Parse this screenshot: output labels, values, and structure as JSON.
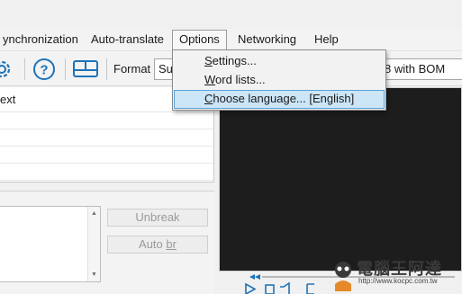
{
  "menubar": {
    "items": [
      {
        "label": "ynchronization"
      },
      {
        "label": "Auto-translate"
      },
      {
        "label": "Options"
      },
      {
        "label": "Networking"
      },
      {
        "label": "Help"
      }
    ]
  },
  "toolbar": {
    "format_label": "Format",
    "format_value": "Su",
    "encoding_value": "8 with BOM",
    "icons": [
      "settings-gear-icon",
      "help-circle-icon",
      "layout-icon"
    ]
  },
  "grid": {
    "header_text": "ext"
  },
  "options_menu": {
    "items": [
      {
        "prefix": "",
        "key": "S",
        "rest": "ettings..."
      },
      {
        "prefix": "",
        "key": "W",
        "rest": "ord lists..."
      },
      {
        "prefix": "",
        "key": "C",
        "rest": "hoose language... [English]"
      }
    ]
  },
  "edit": {
    "unbreak_label": "Unbreak",
    "autobr_label_prefix": "Auto ",
    "autobr_label_key": "br"
  },
  "watermark": {
    "text": "電腦王阿達",
    "url": "http://www.kocpc.com.tw"
  },
  "colors": {
    "highlight_bg": "#cce5f7",
    "highlight_border": "#5aa1d8",
    "icon_blue": "#1e73b8",
    "video_bg": "#1d1d1d"
  }
}
